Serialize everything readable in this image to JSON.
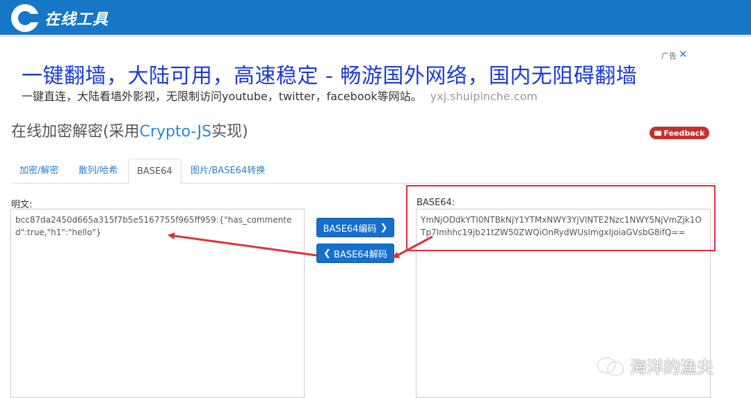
{
  "header": {
    "logo_text": "在线工具"
  },
  "ad": {
    "headline": "一键翻墙，大陆可用，高速稳定 - 畅游国外网络，国内无阻碍翻墙",
    "subtext": "一键直连，大陆看墙外影视，无限制访问youtube，twitter，facebook等网站。",
    "url": "yxj.shuipinche.com",
    "tag": "广告",
    "close": "✕"
  },
  "page": {
    "title_prefix": "在线加密解密(采用",
    "title_highlight": "Crypto-JS",
    "title_suffix": "实现)",
    "feedback_label": "Feedback"
  },
  "tabs": [
    {
      "label": "加密/解密",
      "active": false
    },
    {
      "label": "散列/哈希",
      "active": false
    },
    {
      "label": "BASE64",
      "active": true
    },
    {
      "label": "图片/BASE64转换",
      "active": false
    }
  ],
  "plaintext": {
    "label": "明文:",
    "value": "bcc87da2450d665a315f7b5e5167755f965ff959:{\"has_commented\":true,\"h1\":\"hello\"}"
  },
  "base64": {
    "label": "BASE64:",
    "value": "YmNjODdkYTI0NTBkNjY1YTMxNWY3YjVlNTE2Nzc1NWY5NjVmZjk1OTp7Imhhc19jb21tZW50ZWQiOnRydWUsImgxIjoiaGVsbG8ifQ=="
  },
  "buttons": {
    "encode": "BASE64编码",
    "decode": "BASE64解码"
  },
  "watermark": {
    "text": "海洋的渔夫"
  },
  "colors": {
    "header_blue": "#1677c7",
    "ad_blue": "#1a3bd6",
    "button_blue": "#1570cc",
    "annotation_red": "#e0303a",
    "feedback_red": "#c9302c"
  }
}
